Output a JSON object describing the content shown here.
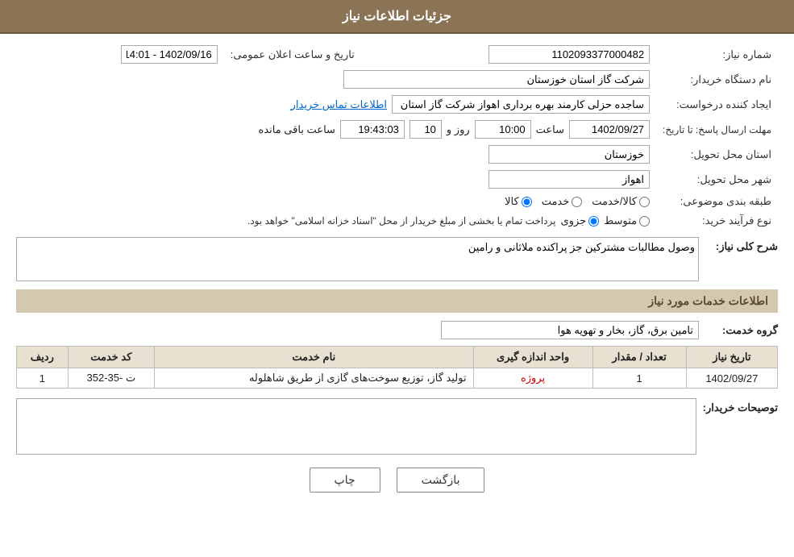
{
  "header": {
    "title": "جزئیات اطلاعات نیاز"
  },
  "fields": {
    "need_number_label": "شماره نیاز:",
    "need_number_value": "1102093377000482",
    "announce_date_label": "تاریخ و ساعت اعلان عمومی:",
    "announce_date_value": "1402/09/16 - 14:01",
    "buyer_name_label": "نام دستگاه خریدار:",
    "buyer_name_value": "شرکت گاز استان خوزستان",
    "creator_label": "ایجاد کننده درخواست:",
    "creator_name": "ساجده حزلی کارمند بهره برداری اهواز شرکت گاز استان خوزستان",
    "creator_link": "اطلاعات تماس خریدار",
    "deadline_label": "مهلت ارسال پاسخ: تا تاریخ:",
    "deadline_date": "1402/09/27",
    "deadline_time_label": "ساعت",
    "deadline_time": "10:00",
    "deadline_day_label": "روز و",
    "deadline_days": "10",
    "deadline_remaining_label": "ساعت باقی مانده",
    "deadline_remaining": "19:43:03",
    "province_label": "استان محل تحویل:",
    "province_value": "خوزستان",
    "city_label": "شهر محل تحویل:",
    "city_value": "اهواز",
    "category_label": "طبقه بندی موضوعی:",
    "radio_kala": "کالا",
    "radio_khadamat": "خدمت",
    "radio_kala_khadamat": "کالا/خدمت",
    "process_label": "نوع فرآیند خرید:",
    "radio_jozvi": "جزوی",
    "radio_motevasset": "متوسط",
    "process_desc": "پرداخت تمام یا بخشی از مبلغ خریدار از محل \"اسناد خزانه اسلامی\" خواهد بود.",
    "need_desc_label": "شرح کلی نیاز:",
    "need_desc_value": "وصول مطالبات مشترکین جز پراکنده ملاثانی و رامین",
    "services_section_label": "اطلاعات خدمات مورد نیاز",
    "service_group_label": "گروه خدمت:",
    "service_group_value": "تامین برق، گاز، بخار و تهویه هوا",
    "table_headers": {
      "row_num": "ردیف",
      "service_code": "کد خدمت",
      "service_name": "نام خدمت",
      "unit": "واحد اندازه گیری",
      "quantity": "تعداد / مقدار",
      "date": "تاریخ نیاز"
    },
    "table_rows": [
      {
        "row_num": "1",
        "service_code": "ت -35-352",
        "service_name": "تولید گاز، توزیع سوخت‌های گازی از طریق شاهلوله",
        "unit": "پروژه",
        "quantity": "1",
        "date": "1402/09/27"
      }
    ],
    "buyer_desc_label": "توصیحات خریدار:"
  },
  "buttons": {
    "print": "چاپ",
    "back": "بازگشت"
  }
}
